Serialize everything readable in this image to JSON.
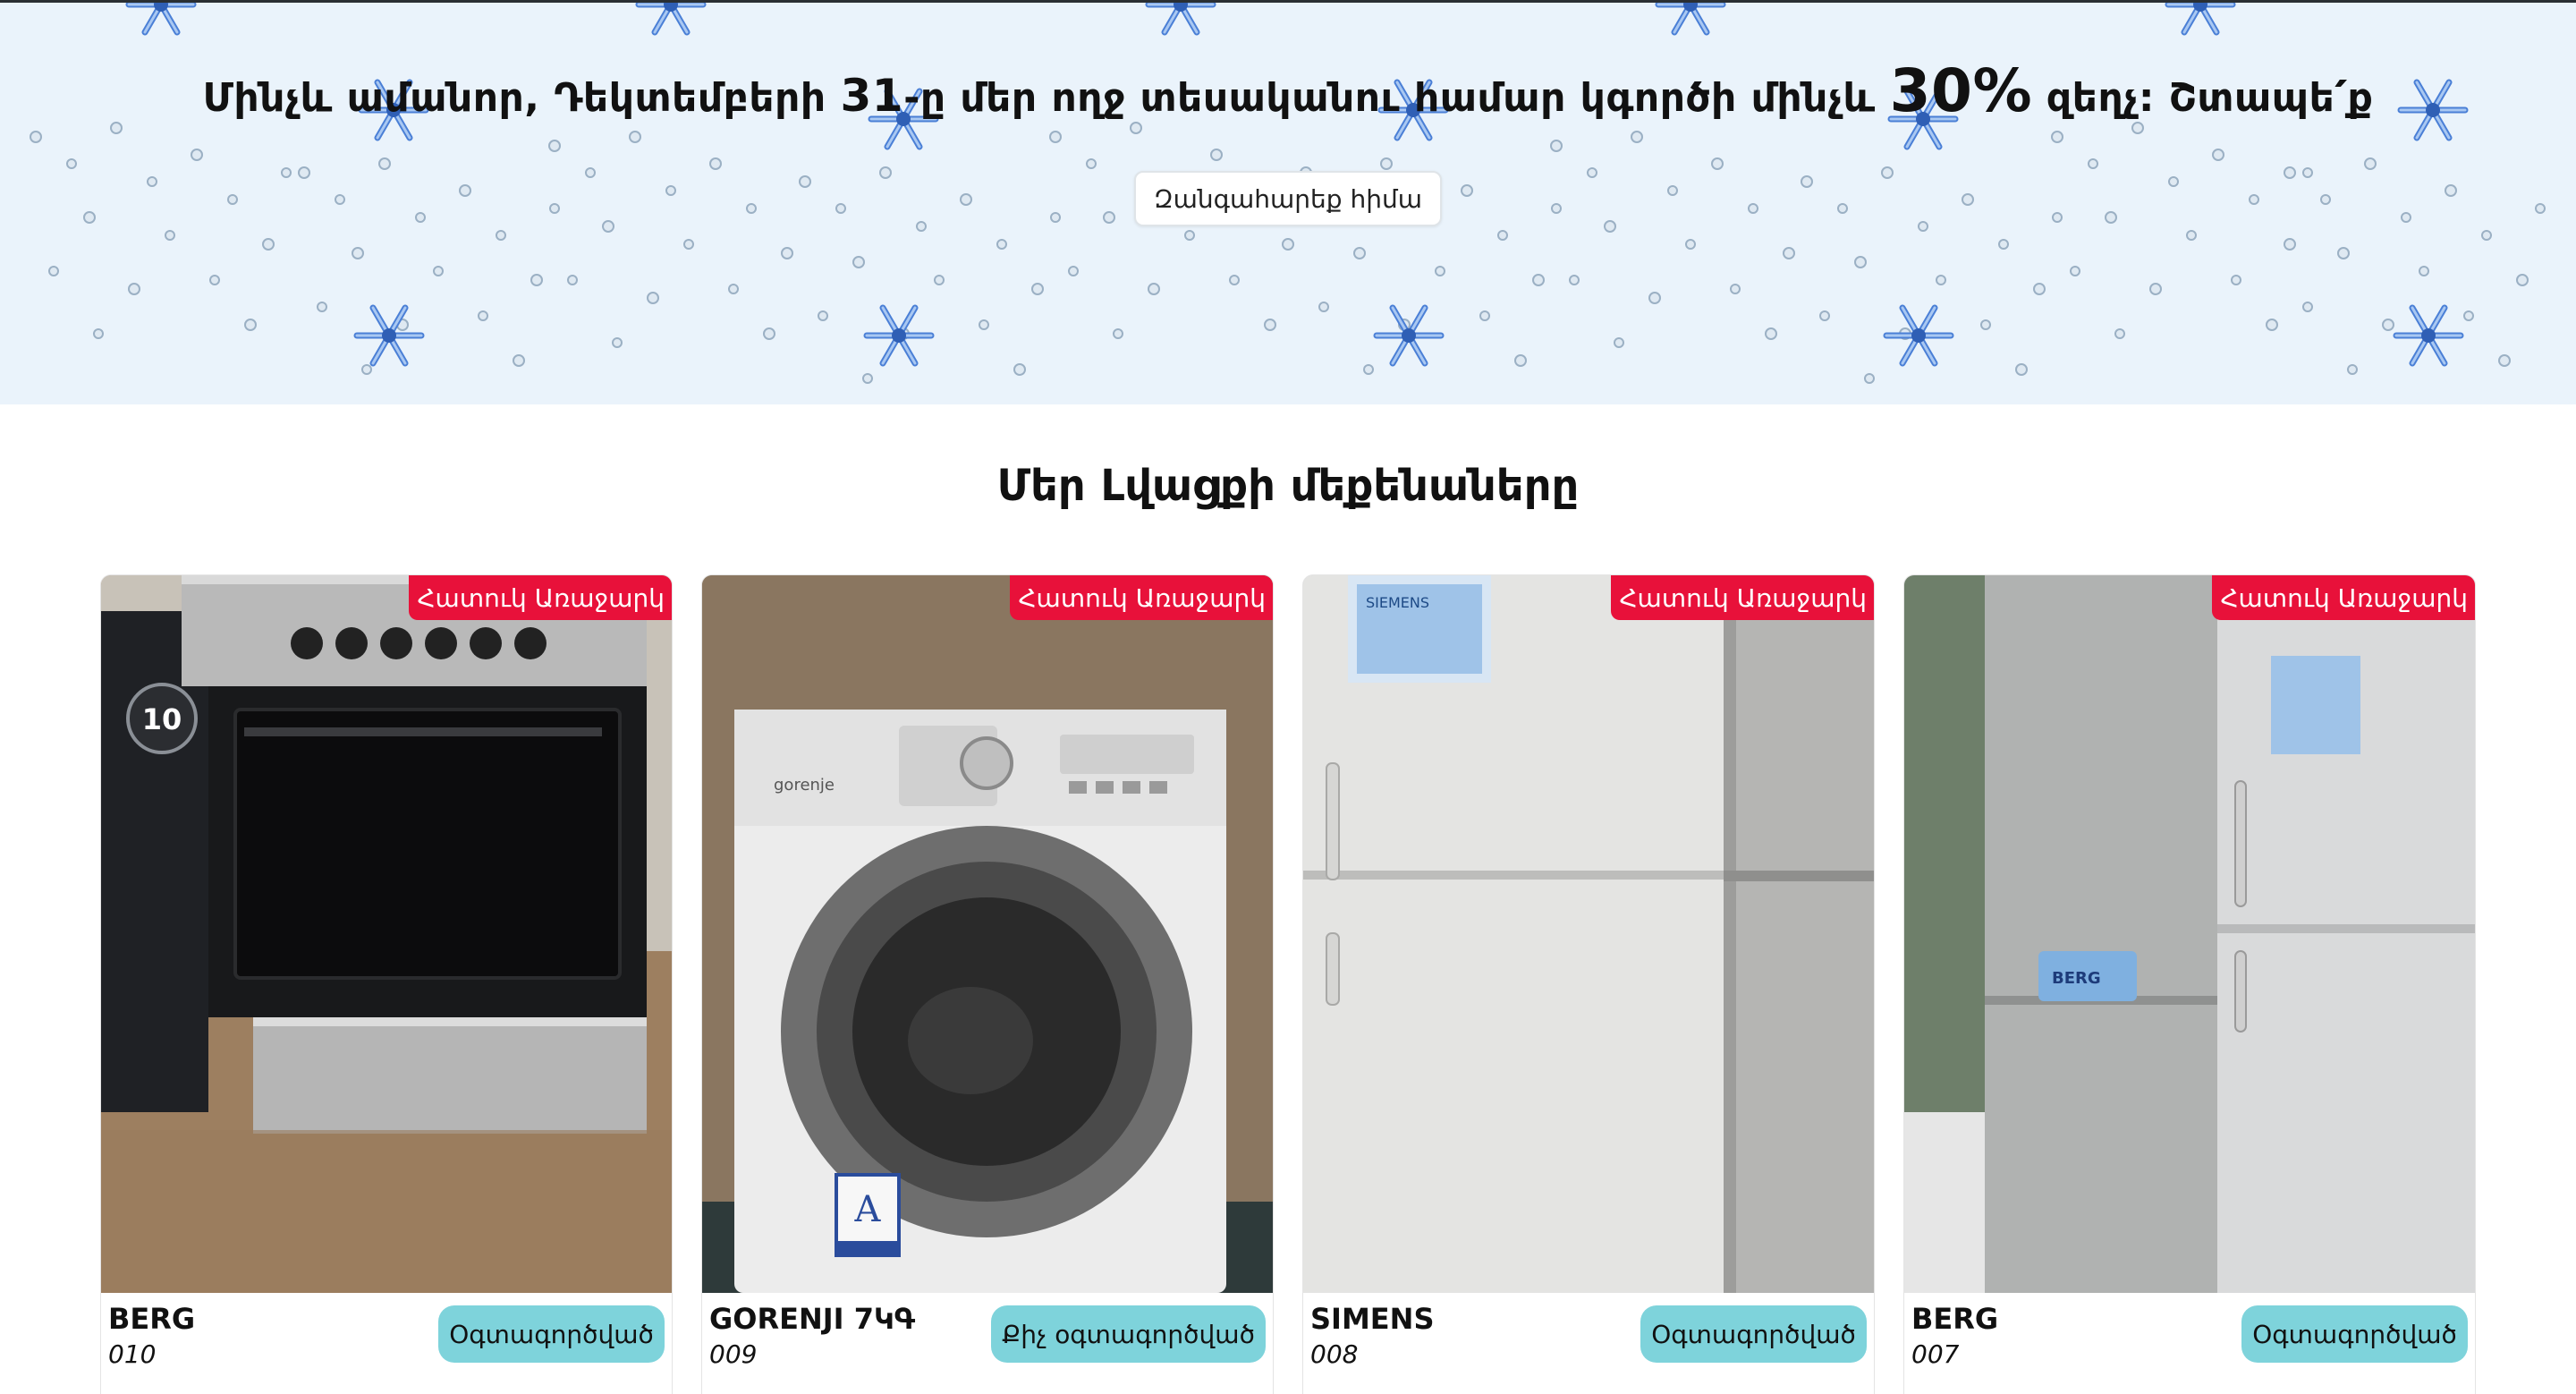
{
  "banner": {
    "text_before": "Մինչև ամանոր, Դեկտեմբերի ",
    "text_bold_date": "31",
    "text_middle": "-ը մեր ողջ տեսականու համար կգործի մինչև ",
    "text_percent": "30%",
    "text_after": " զեղչ: Շտապե՛ք",
    "cta_label": "Զանգահարեք հիմա"
  },
  "section": {
    "title": "Մեր Լվացքի մեքենաները"
  },
  "products": [
    {
      "badge": "Հատուկ Առաջարկ",
      "brand": "BERG",
      "code": "010",
      "status": "Օգտագործված",
      "image": "stove-oven"
    },
    {
      "badge": "Հատուկ Առաջարկ",
      "brand": "GORENJI 7ԿԳ",
      "code": "009",
      "status": "Քիչ օգտագործված",
      "image": "washing-machine"
    },
    {
      "badge": "Հատուկ Առաջարկ",
      "brand": "SIMENS",
      "code": "008",
      "status": "Օգտագործված",
      "image": "refrigerator"
    },
    {
      "badge": "Հատուկ Առաջարկ",
      "brand": "BERG",
      "code": "007",
      "status": "Օգտագործված",
      "image": "refrigerator"
    }
  ],
  "colors": {
    "badge": "#e8113a",
    "status_pill": "#7ed3db",
    "banner_bg": "#eaf3fb"
  }
}
